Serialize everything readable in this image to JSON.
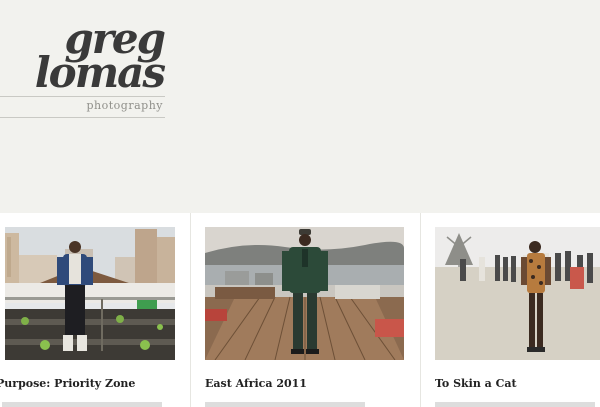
{
  "site": {
    "logo_line1": "greg",
    "logo_line2": "lomas",
    "tagline": "photography"
  },
  "projects": [
    {
      "title": "Purpose: Priority Zone",
      "thumb_icon": "photo-urban-rooftop-man"
    },
    {
      "title": "East Africa 2011",
      "thumb_icon": "photo-man-on-pier"
    },
    {
      "title": "To Skin a Cat",
      "thumb_icon": "photo-girl-in-crowd"
    }
  ]
}
